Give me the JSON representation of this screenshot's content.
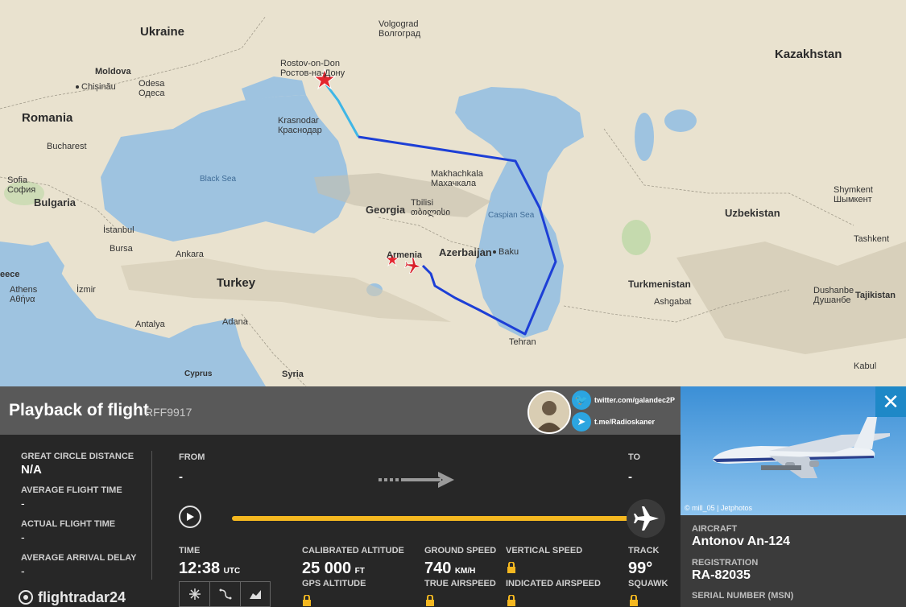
{
  "map": {
    "countries": [
      {
        "id": "ukraine",
        "label": "Ukraine"
      },
      {
        "id": "kazakhstan",
        "label": "Kazakhstan"
      },
      {
        "id": "romania",
        "label": "Romania"
      },
      {
        "id": "moldova",
        "label": "Moldova"
      },
      {
        "id": "bulgaria",
        "label": "Bulgaria"
      },
      {
        "id": "georgia",
        "label": "Georgia"
      },
      {
        "id": "armenia",
        "label": "Armenia"
      },
      {
        "id": "azerbaijan",
        "label": "Azerbaijan"
      },
      {
        "id": "turkey",
        "label": "Turkey"
      },
      {
        "id": "uzbekistan",
        "label": "Uzbekistan"
      },
      {
        "id": "turkmenistan",
        "label": "Turkmenistan"
      },
      {
        "id": "tajikistan",
        "label": "Tajikistan"
      },
      {
        "id": "syria",
        "label": "Syria"
      },
      {
        "id": "cyprus",
        "label": "Cyprus"
      },
      {
        "id": "greece",
        "label": "eece"
      }
    ],
    "cities": [
      {
        "id": "volgograd",
        "label": "Volgograd",
        "alt": "Волгоград"
      },
      {
        "id": "rostov",
        "label": "Rostov-on-Don",
        "alt": "Ростов-на-Дону"
      },
      {
        "id": "krasnodar",
        "label": "Krasnodar",
        "alt": "Краснодар"
      },
      {
        "id": "odesa",
        "label": "Odesa",
        "alt": "Одеса"
      },
      {
        "id": "chisinau",
        "label": "Chișinău"
      },
      {
        "id": "bucharest",
        "label": "Bucharest"
      },
      {
        "id": "sofia",
        "label": "Sofia",
        "alt": "София"
      },
      {
        "id": "istanbul",
        "label": "İstanbul"
      },
      {
        "id": "bursa",
        "label": "Bursa"
      },
      {
        "id": "ankara",
        "label": "Ankara"
      },
      {
        "id": "izmir",
        "label": "İzmir"
      },
      {
        "id": "athens",
        "label": "Athens",
        "alt": "Αθήνα"
      },
      {
        "id": "antalya",
        "label": "Antalya"
      },
      {
        "id": "adana",
        "label": "Adana"
      },
      {
        "id": "makhachkala",
        "label": "Makhachkala",
        "alt": "Махачкала"
      },
      {
        "id": "tbilisi",
        "label": "Tbilisi",
        "alt": "თბილისი"
      },
      {
        "id": "baku",
        "label": "Baku"
      },
      {
        "id": "tehran",
        "label": "Tehran"
      },
      {
        "id": "ashgabat",
        "label": "Ashgabat"
      },
      {
        "id": "dushanbe",
        "label": "Dushanbe",
        "alt": "Душанбе"
      },
      {
        "id": "shymkent",
        "label": "Shymkent",
        "alt": "Шымкент"
      },
      {
        "id": "tashkent",
        "label": "Tashkent"
      },
      {
        "id": "kabul",
        "label": "Kabul"
      }
    ],
    "seas": [
      {
        "id": "black-sea",
        "label": "Black Sea"
      },
      {
        "id": "caspian-sea",
        "label": "Caspian Sea"
      }
    ],
    "route_color": "#1d3fd6",
    "route_start_color": "#3fb6e6",
    "marker_color": "#e3262f"
  },
  "panel": {
    "title": "Playback of flight",
    "callsign": "RFF9917",
    "twitter": "twitter.com/galandec2P",
    "telegram": "t.me/Radioskaner",
    "great_circle_label": "GREAT CIRCLE DISTANCE",
    "great_circle_value": "N/A",
    "avg_flight_time_label": "AVERAGE FLIGHT TIME",
    "avg_flight_time_value": "-",
    "actual_flight_time_label": "ACTUAL FLIGHT TIME",
    "actual_flight_time_value": "-",
    "avg_arrival_delay_label": "AVERAGE ARRIVAL DELAY",
    "avg_arrival_delay_value": "-",
    "from_label": "FROM",
    "from_value": "-",
    "to_label": "TO",
    "to_value": "-",
    "time_label": "TIME",
    "time_value": "12:38",
    "time_unit": "UTC",
    "cal_alt_label": "CALIBRATED ALTITUDE",
    "cal_alt_value": "25 000",
    "cal_alt_unit": "FT",
    "gps_alt_label": "GPS ALTITUDE",
    "ground_speed_label": "GROUND SPEED",
    "ground_speed_value": "740",
    "ground_speed_unit": "KM/H",
    "true_airspeed_label": "TRUE AIRSPEED",
    "vertical_speed_label": "VERTICAL SPEED",
    "indicated_airspeed_label": "INDICATED AIRSPEED",
    "track_label": "TRACK",
    "track_value": "99°",
    "squawk_label": "SQUAWK",
    "playback_progress": 1.0,
    "logo": "flightradar24"
  },
  "aircraft": {
    "photo_credit": "© mill_05 | Jetphotos",
    "aircraft_label": "AIRCRAFT",
    "aircraft_value": "Antonov An-124",
    "registration_label": "REGISTRATION",
    "registration_value": "RA-82035",
    "serial_label": "SERIAL NUMBER (MSN)"
  },
  "colors": {
    "accent": "#f5b820",
    "close_button": "#1e88c7",
    "panel_bg": "#272727",
    "titlebar_bg": "#595959"
  }
}
